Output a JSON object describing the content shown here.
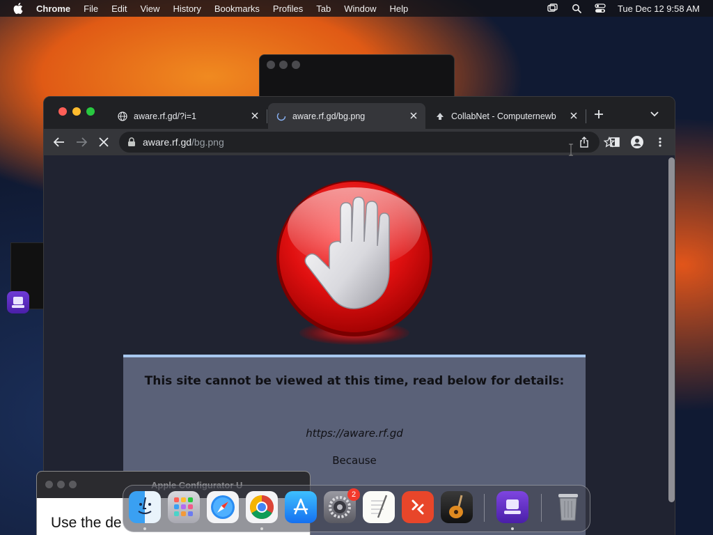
{
  "menubar": {
    "app_name": "Chrome",
    "items": [
      "File",
      "Edit",
      "View",
      "History",
      "Bookmarks",
      "Profiles",
      "Tab",
      "Window",
      "Help"
    ],
    "clock": "Tue Dec 12  9:58 AM",
    "status_icons": [
      "screen-mirroring-icon",
      "spotlight-search-icon",
      "control-center-icon"
    ]
  },
  "browser": {
    "tabs": [
      {
        "title": "aware.rf.gd/?i=1",
        "icon": "globe-icon",
        "active": false
      },
      {
        "title": "aware.rf.gd/bg.png",
        "icon": "loading-globe-icon",
        "active": true
      },
      {
        "title": "CollabNet - Computernewb",
        "icon": "collabnet-icon",
        "active": false
      }
    ],
    "address": {
      "host": "aware.rf.gd",
      "path": "/bg.png"
    },
    "colors": {
      "tabstrip": "#202124",
      "toolbar": "#35363a",
      "page_bg": "#202331"
    }
  },
  "page": {
    "heading": "This site cannot be viewed at this time, read below for details:",
    "site": "https://aware.rf.gd",
    "because": "Because",
    "colors": {
      "box": "#5a6178",
      "box_border": "#a8c8ef",
      "stop_red": "#e01010"
    }
  },
  "config_window": {
    "title": "Apple Configurator U",
    "body_text": "Use the de"
  },
  "dock": {
    "apps": [
      {
        "name": "Finder",
        "icon": "finder-icon",
        "running": true
      },
      {
        "name": "Launchpad",
        "icon": "launchpad-icon",
        "running": false
      },
      {
        "name": "Safari",
        "icon": "safari-icon",
        "running": false
      },
      {
        "name": "Google Chrome",
        "icon": "chrome-icon",
        "running": true
      },
      {
        "name": "App Store",
        "icon": "app-store-icon",
        "running": false
      },
      {
        "name": "System Settings",
        "icon": "system-settings-icon",
        "running": false,
        "badge": "2"
      },
      {
        "name": "TextEdit",
        "icon": "textedit-icon",
        "running": false
      },
      {
        "name": "Microsoft Remote Desktop",
        "icon": "remote-desktop-icon",
        "running": false
      },
      {
        "name": "GarageBand",
        "icon": "garageband-icon",
        "running": false
      },
      {
        "name": "Apple Configurator",
        "icon": "apple-configurator-icon",
        "running": true
      },
      {
        "name": "Trash",
        "icon": "trash-icon",
        "running": false
      }
    ]
  }
}
